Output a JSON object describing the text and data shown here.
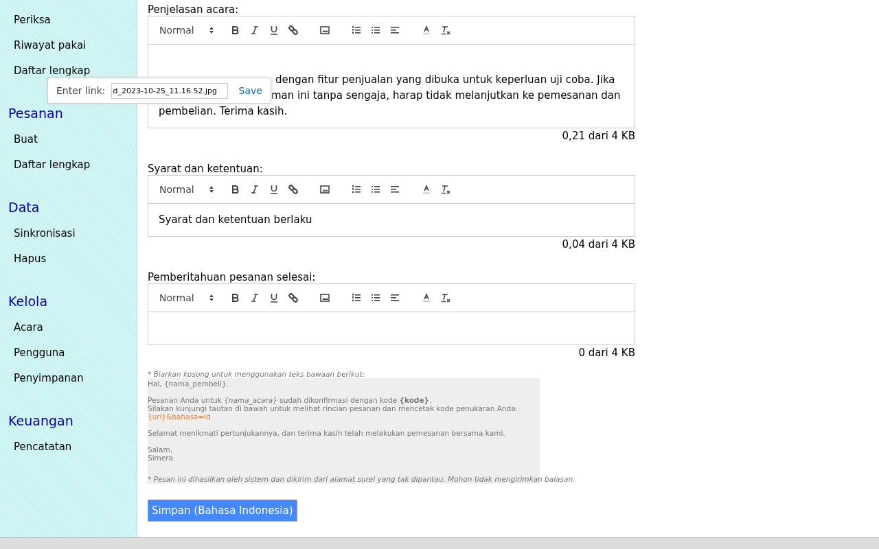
{
  "sidebar": {
    "sections": [
      {
        "items": [
          "Periksa",
          "Riwayat pakai",
          "Daftar lengkap"
        ]
      },
      {
        "heading": "Pesanan",
        "items": [
          "Buat",
          "Daftar lengkap"
        ]
      },
      {
        "heading": "Data",
        "items": [
          "Sinkronisasi",
          "Hapus"
        ]
      },
      {
        "heading": "Kelola",
        "items": [
          "Acara",
          "Pengguna",
          "Penyimpanan"
        ]
      },
      {
        "heading": "Keuangan",
        "items": [
          "Pencatatan"
        ]
      }
    ]
  },
  "editors": [
    {
      "label": "Penjelasan acara:",
      "format": "Normal",
      "leading_blank": true,
      "content_lines": [
        "dengan fitur penjualan yang dibuka untuk keperluan uji coba. Jika",
        "man ini tanpa sengaja, harap tidak melanjutkan ke pemesanan dan",
        "pembelian. Terima kasih."
      ],
      "size": "0,21 dari 4 KB"
    },
    {
      "label": "Syarat dan ketentuan:",
      "format": "Normal",
      "leading_blank": false,
      "content_lines": [
        "Syarat dan ketentuan berlaku"
      ],
      "size": "0,04 dari 4 KB"
    },
    {
      "label": "Pemberitahuan pesanan selesai:",
      "format": "Normal",
      "leading_blank": false,
      "size": "0 dari 4 KB"
    }
  ],
  "default_text": {
    "hint": "* Biarkan kosong untuk menggunakan teks bawaan berikut:",
    "paragraphs": [
      {
        "lines": [
          {
            "kind": "plain",
            "text": "Hai, {nama_pembeli}."
          }
        ]
      },
      {
        "lines": [
          {
            "kind": "plain",
            "text": "Pesanan Anda untuk *{nama_acara}* sudah dikonfirmasi dengan kode **{kode}**."
          },
          {
            "kind": "plain",
            "text": "Silakan kunjungi tautan di bawah untuk melihat rincian pesanan dan mencetak kode penukaran Anda:"
          },
          {
            "kind": "link",
            "text": "{url}&bahasa=id"
          }
        ]
      },
      {
        "lines": [
          {
            "kind": "plain",
            "text": "Selamat menikmati pertunjukannya, dan terima kasih telah melakukan pemesanan bersama kami."
          }
        ]
      },
      {
        "lines": [
          {
            "kind": "plain",
            "text": "Salam,"
          },
          {
            "kind": "plain",
            "text": "Simera."
          }
        ]
      }
    ],
    "footnote": "* Pesan ini dihasilkan oleh sistem dan dikirim dari alamat surel yang tak dipantau. Mohon tidak mengirimkan balasan."
  },
  "save_button": "Simpan (Bahasa Indonesia)",
  "link_popup": {
    "label": "Enter link:",
    "value": "d_2023-10-25_11.16.52.jpg",
    "action": "Save"
  }
}
